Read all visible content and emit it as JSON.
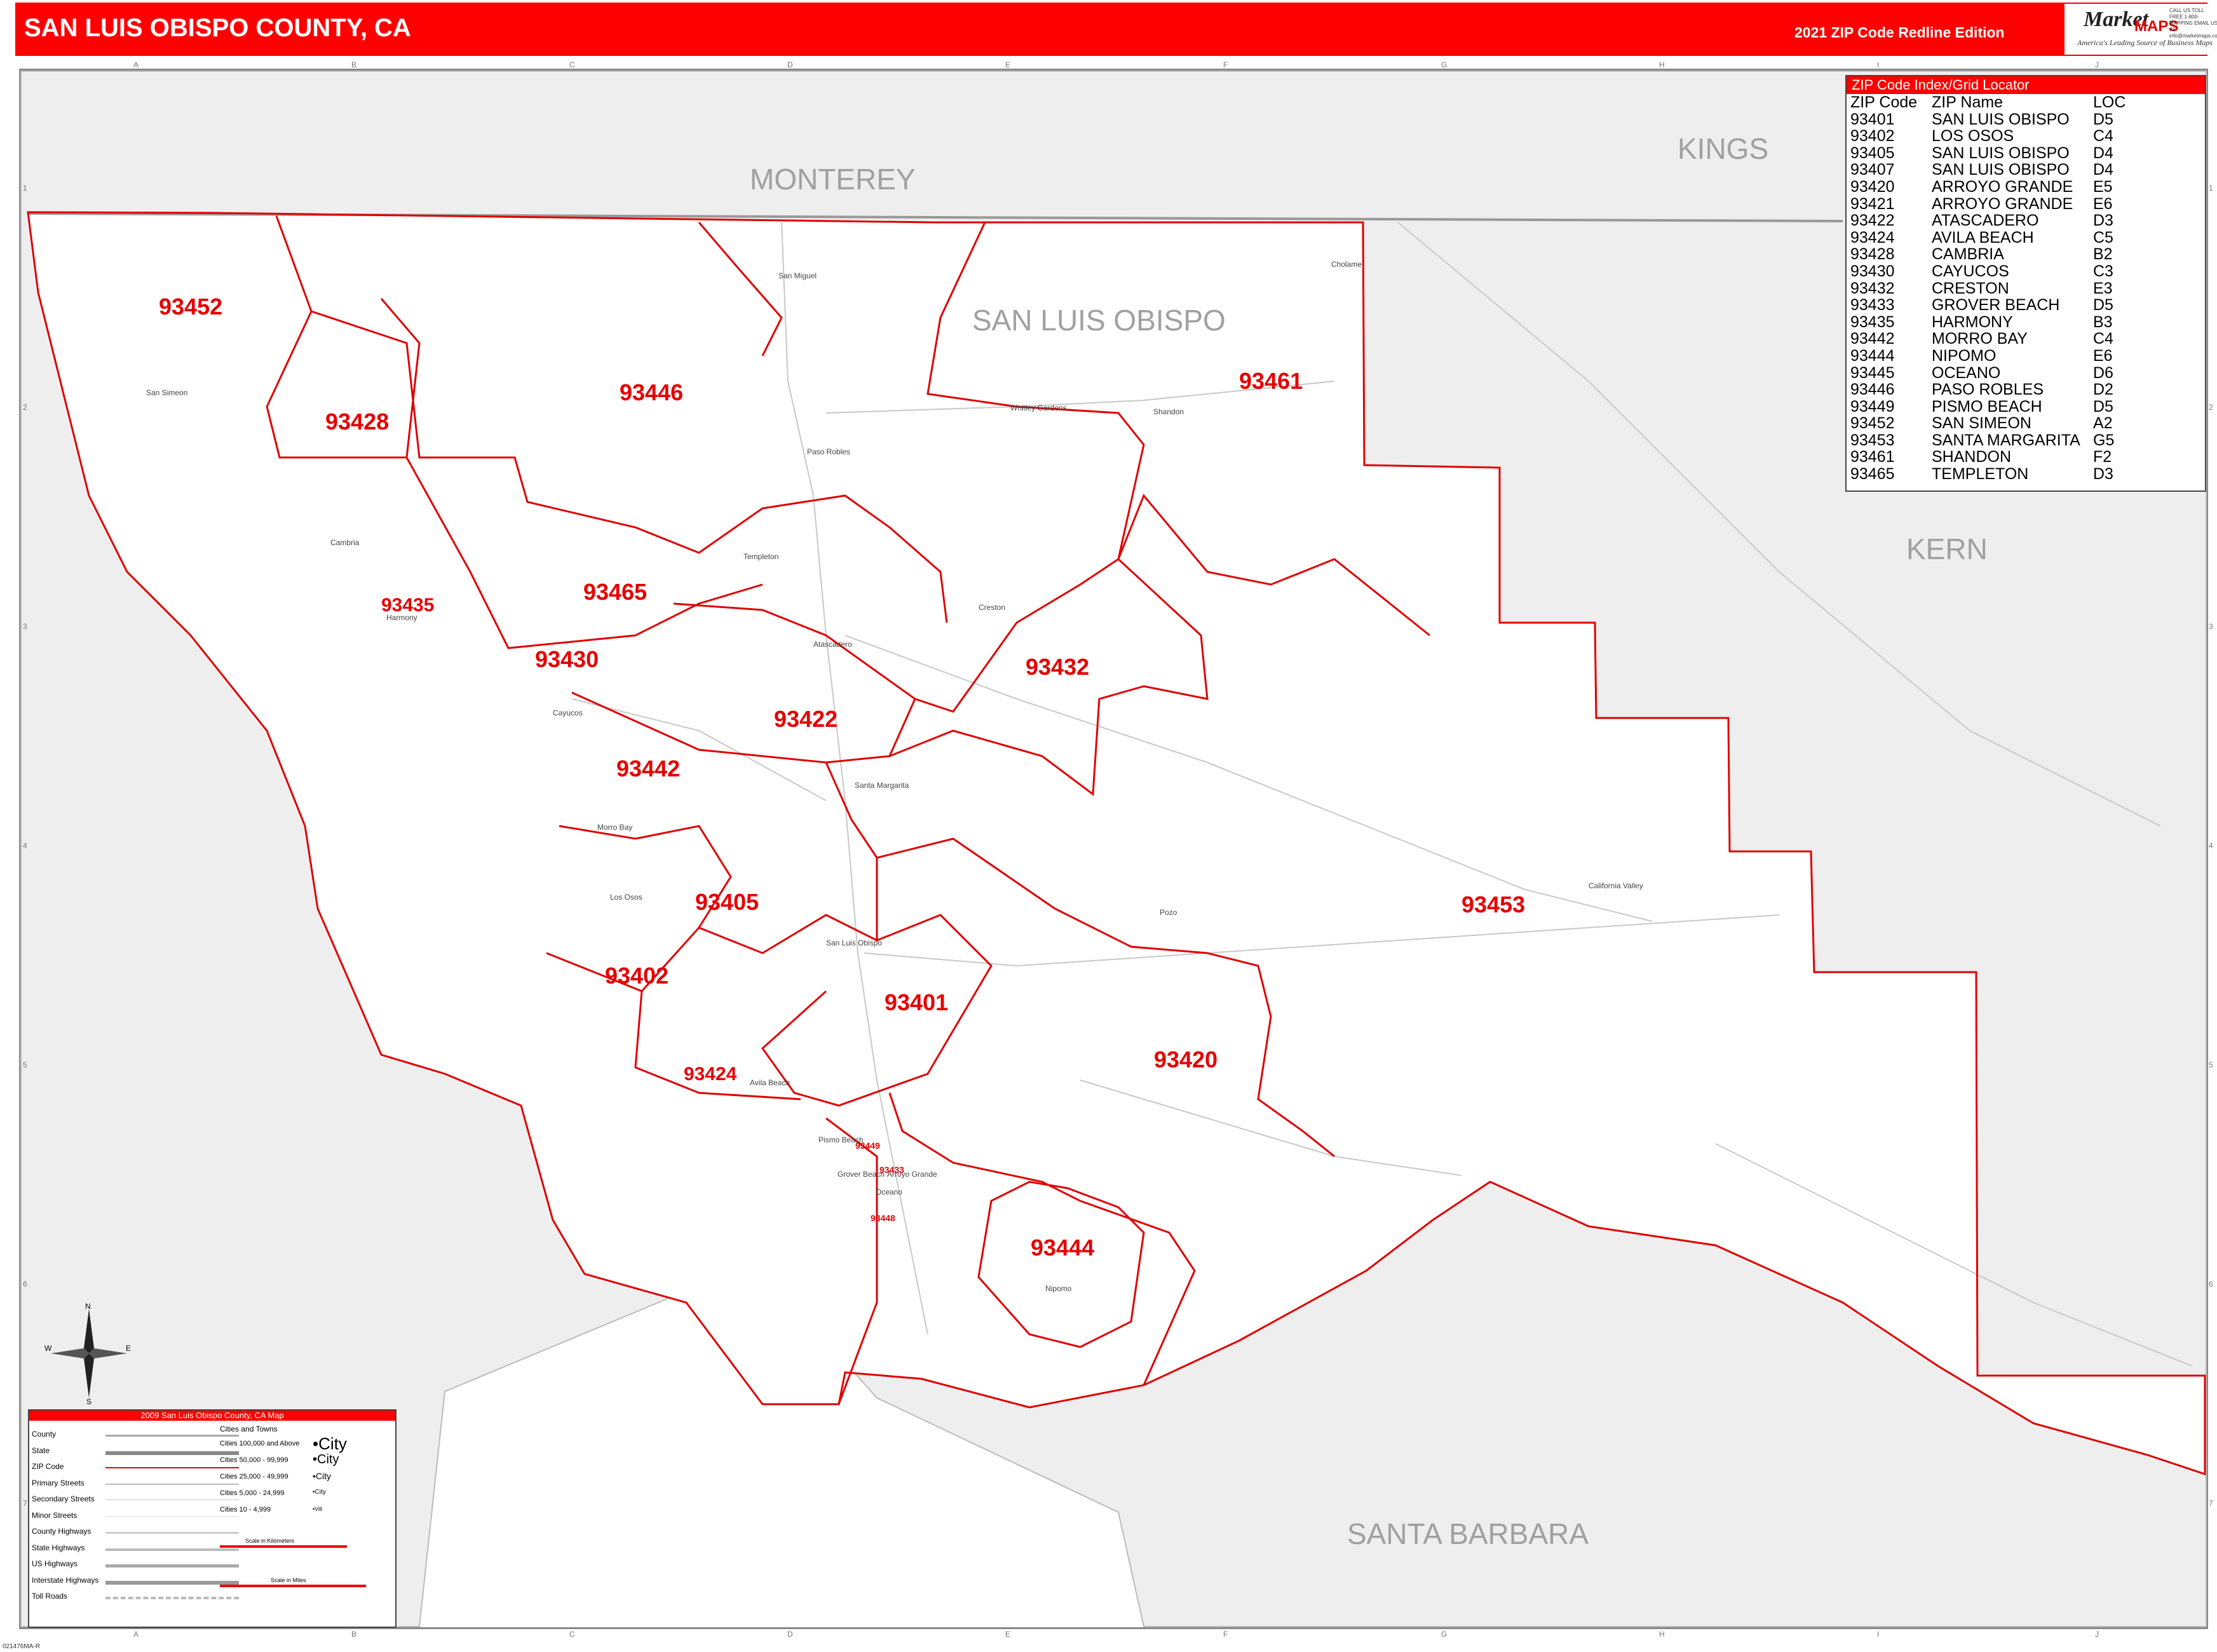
{
  "header": {
    "title": "SAN LUIS OBISPO COUNTY, CA",
    "edition": "2021 ZIP Code Redline Edition",
    "logo_market": "Market",
    "logo_maps": "MAPS",
    "logo_tagline": "America's Leading Source of Business Maps",
    "logo_contact": "CALL US TOLL FREE 1-800-MAPPING EMAIL US AT info@marketmaps.com"
  },
  "colors": {
    "accent": "#ff0000",
    "zip_boundary": "#e00000",
    "outside_county": "#eeeeee"
  },
  "map": {
    "counties": [
      "MONTEREY",
      "KINGS",
      "SAN LUIS OBISPO",
      "KERN",
      "SANTA BARBARA"
    ],
    "zip_labels": [
      "93452",
      "93428",
      "93446",
      "93461",
      "93465",
      "93435",
      "93430",
      "93422",
      "93432",
      "93442",
      "93405",
      "93453",
      "93402",
      "93401",
      "93420",
      "93424",
      "93444",
      "93449",
      "93433",
      "93448"
    ],
    "towns": [
      "San Miguel",
      "Paso Robles",
      "Templeton",
      "Atascadero",
      "Cambria",
      "Cayucos",
      "Morro Bay",
      "Los Osos",
      "San Luis Obispo",
      "Santa Margarita",
      "California Valley",
      "Avila Beach",
      "Pismo Beach",
      "Grover Beach",
      "Arroyo Grande",
      "Oceano",
      "Nipomo",
      "Shandon",
      "Creston",
      "San Simeon",
      "Harmony",
      "Whitley Gardens",
      "Pozo",
      "Cholame"
    ],
    "grid_columns": [
      "A",
      "B",
      "C",
      "D",
      "E",
      "F",
      "G",
      "H",
      "I",
      "J"
    ],
    "grid_rows": [
      "1",
      "2",
      "3",
      "4",
      "5",
      "6",
      "7"
    ]
  },
  "zip_index": {
    "title": "ZIP Code Index/Grid Locator",
    "headers": [
      "ZIP Code",
      "ZIP Name",
      "LOC"
    ],
    "rows": [
      [
        "93401",
        "SAN LUIS OBISPO",
        "D5"
      ],
      [
        "93402",
        "LOS OSOS",
        "C4"
      ],
      [
        "93405",
        "SAN LUIS OBISPO",
        "D4"
      ],
      [
        "93407",
        "SAN LUIS OBISPO",
        "D4"
      ],
      [
        "93420",
        "ARROYO GRANDE",
        "E5"
      ],
      [
        "93421",
        "ARROYO GRANDE",
        "E6"
      ],
      [
        "93422",
        "ATASCADERO",
        "D3"
      ],
      [
        "93424",
        "AVILA BEACH",
        "C5"
      ],
      [
        "93428",
        "CAMBRIA",
        "B2"
      ],
      [
        "93430",
        "CAYUCOS",
        "C3"
      ],
      [
        "93432",
        "CRESTON",
        "E3"
      ],
      [
        "93433",
        "GROVER BEACH",
        "D5"
      ],
      [
        "93435",
        "HARMONY",
        "B3"
      ],
      [
        "93442",
        "MORRO BAY",
        "C4"
      ],
      [
        "93444",
        "NIPOMO",
        "E6"
      ],
      [
        "93445",
        "OCEANO",
        "D6"
      ],
      [
        "93446",
        "PASO ROBLES",
        "D2"
      ],
      [
        "93449",
        "PISMO BEACH",
        "D5"
      ],
      [
        "93452",
        "SAN SIMEON",
        "A2"
      ],
      [
        "93453",
        "SANTA MARGARITA",
        "G5"
      ],
      [
        "93461",
        "SHANDON",
        "F2"
      ],
      [
        "93465",
        "TEMPLETON",
        "D3"
      ]
    ]
  },
  "legend": {
    "title": "2009 San Luis Obispo County, CA Map",
    "items": [
      "County",
      "State",
      "ZIP Code",
      "Primary Streets",
      "Secondary Streets",
      "Minor Streets",
      "County Highways",
      "State Highways",
      "US Highways",
      "Interstate Highways",
      "Toll Roads"
    ],
    "cities_header": "Cities and Towns",
    "city_classes": [
      "Cities 100,000 and Above",
      "Cities 50,000 - 99,999",
      "Cities 25,000 - 49,999",
      "Cities 5,000 - 24,999",
      "Cities 10 - 4,999"
    ],
    "city_samples": [
      "•City",
      "•City",
      "•City",
      "•City",
      "•Vill"
    ],
    "scale_km": "Scale in Kilometers",
    "scale_mi": "Scale in Miles"
  },
  "compass": {
    "n": "N",
    "s": "S",
    "e": "E",
    "w": "W"
  },
  "footer_code": "021476MA-R"
}
